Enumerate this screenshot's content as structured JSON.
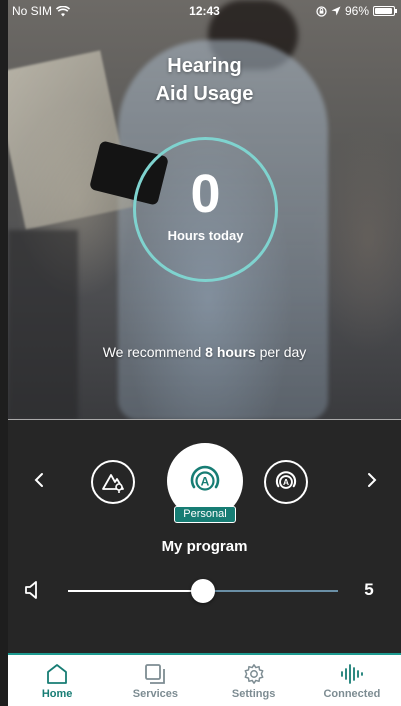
{
  "status_bar": {
    "carrier": "No SIM",
    "time": "12:43",
    "battery_text": "96%",
    "battery_level": 0.96
  },
  "title": {
    "line1": "Hearing",
    "line2": "Aid Usage"
  },
  "usage": {
    "value": "0",
    "label": "Hours today"
  },
  "recommendation": {
    "prefix": "We recommend ",
    "highlight": "8 hours",
    "suffix": " per day"
  },
  "program": {
    "badge": "Personal",
    "name": "My program"
  },
  "volume": {
    "value": "5",
    "level": 0.5
  },
  "tabs": [
    {
      "label": "Home",
      "icon": "home-icon",
      "active": true
    },
    {
      "label": "Services",
      "icon": "services-icon",
      "active": false
    },
    {
      "label": "Settings",
      "icon": "settings-gear-icon",
      "active": false
    },
    {
      "label": "Connected",
      "icon": "soundwave-icon",
      "active": false
    }
  ],
  "colors": {
    "accent": "#177d74",
    "ring": "#7fd3cf",
    "panel": "#262626",
    "tab_inactive": "#7d8c92"
  }
}
